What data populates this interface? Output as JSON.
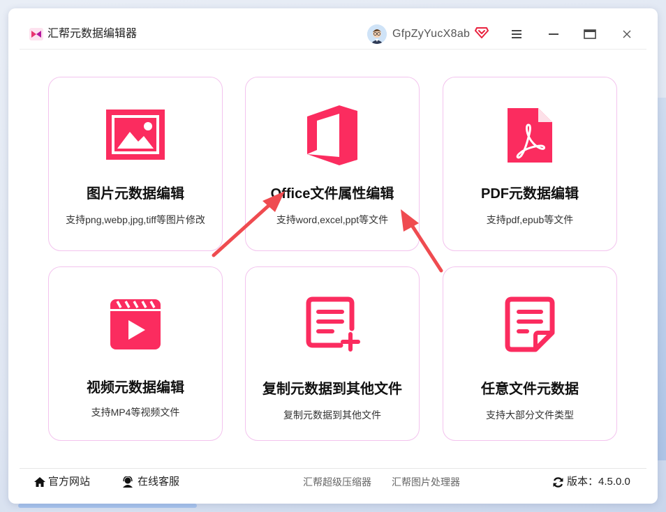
{
  "app": {
    "title": "汇帮元数据编辑器"
  },
  "user": {
    "name": "GfpZyYucX8ab"
  },
  "icons": {
    "logo": "app-logo-icon",
    "vip": "diamond-vip-icon",
    "menu": "menu-icon",
    "minimize": "minimize-icon",
    "maximize": "maximize-icon",
    "close": "close-icon",
    "home": "home-icon",
    "support": "support-agent-icon",
    "refresh": "refresh-icon"
  },
  "colors": {
    "accent": "#fb2c5f",
    "card_border": "#f3c3ee"
  },
  "cards": [
    {
      "title": "图片元数据编辑",
      "desc": "支持png,webp,jpg,tiff等图片修改",
      "icon": "image-icon"
    },
    {
      "title": "Office文件属性编辑",
      "desc": "支持word,excel,ppt等文件",
      "icon": "office-icon"
    },
    {
      "title": "PDF元数据编辑",
      "desc": "支持pdf,epub等文件",
      "icon": "pdf-icon"
    },
    {
      "title": "视频元数据编辑",
      "desc": "支持MP4等视频文件",
      "icon": "video-icon"
    },
    {
      "title": "复制元数据到其他文件",
      "desc": "复制元数据到其他文件",
      "icon": "document-add-icon"
    },
    {
      "title": "任意文件元数据",
      "desc": "支持大部分文件类型",
      "icon": "document-icon"
    }
  ],
  "footer": {
    "website": "官方网站",
    "support": "在线客服",
    "compressor": "汇帮超级压缩器",
    "image_tool": "汇帮图片处理器",
    "version_label": "版本：",
    "version": "4.5.0.0"
  }
}
